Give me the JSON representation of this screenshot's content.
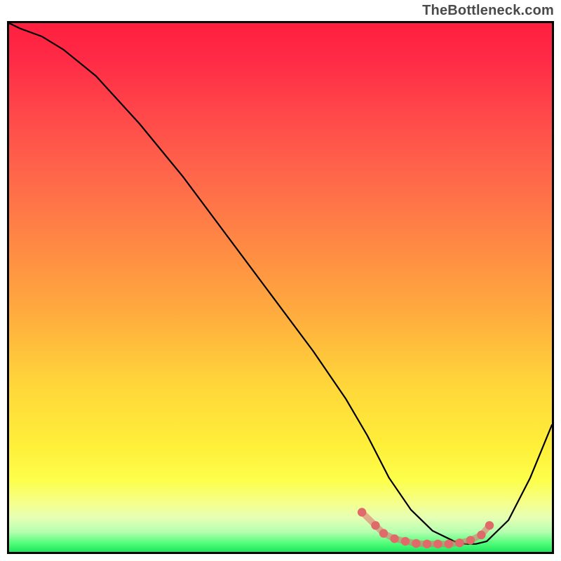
{
  "watermark": "TheBottleneck.com",
  "chart_data": {
    "type": "line",
    "title": "",
    "xlabel": "",
    "ylabel": "",
    "xlim": [
      0,
      100
    ],
    "ylim": [
      0,
      100
    ],
    "series": [
      {
        "name": "curve",
        "style": "black-line",
        "x": [
          0,
          2,
          6,
          10,
          16,
          24,
          32,
          40,
          48,
          56,
          62,
          66,
          68,
          70,
          74,
          78,
          82,
          84,
          86,
          88,
          92,
          96,
          100
        ],
        "y": [
          100,
          99,
          97.5,
          95,
          90,
          81,
          71,
          60,
          49,
          38,
          29,
          22,
          18,
          14,
          8,
          4,
          2,
          1.5,
          1.5,
          2,
          6,
          14,
          24
        ]
      },
      {
        "name": "optimal-zone-dots",
        "style": "coral-dots",
        "x": [
          65,
          67.5,
          69,
          71,
          73,
          75,
          77,
          79,
          81,
          83,
          85,
          87,
          88.5
        ],
        "y": [
          7.5,
          5,
          3.5,
          2.5,
          2,
          1.6,
          1.5,
          1.5,
          1.5,
          1.7,
          2.2,
          3.2,
          5
        ]
      }
    ],
    "background_gradient": {
      "stops": [
        {
          "pos": 0.0,
          "color": "#ff1f3f"
        },
        {
          "pos": 0.07,
          "color": "#ff2b46"
        },
        {
          "pos": 0.18,
          "color": "#ff4a4a"
        },
        {
          "pos": 0.3,
          "color": "#ff6a4a"
        },
        {
          "pos": 0.42,
          "color": "#ff8944"
        },
        {
          "pos": 0.55,
          "color": "#ffac3e"
        },
        {
          "pos": 0.68,
          "color": "#ffd53a"
        },
        {
          "pos": 0.8,
          "color": "#ffef3a"
        },
        {
          "pos": 0.865,
          "color": "#fdff4a"
        },
        {
          "pos": 0.905,
          "color": "#f6ff88"
        },
        {
          "pos": 0.935,
          "color": "#e6ffb4"
        },
        {
          "pos": 0.962,
          "color": "#b6ffb0"
        },
        {
          "pos": 0.985,
          "color": "#4dfc77"
        },
        {
          "pos": 1.0,
          "color": "#1ee65f"
        }
      ]
    }
  }
}
